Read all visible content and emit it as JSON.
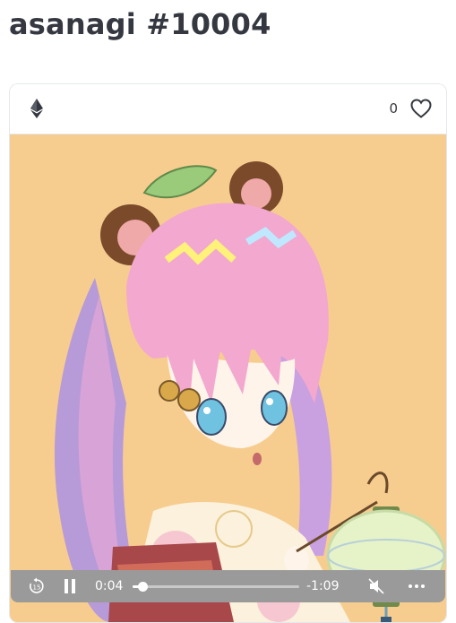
{
  "page": {
    "title": "asanagi #10004"
  },
  "card": {
    "chain_icon": "ethereum-icon",
    "favorites_count": "0",
    "favorite_icon": "heart-outline-icon",
    "image_alt": "Anime girl with pink and purple twin-tail hair and bear ears, wearing a floral kimono, holding a glowing paper lantern"
  },
  "player": {
    "rewind_icon": "rewind-15-icon",
    "rewind_label": "15",
    "pause_icon": "pause-icon",
    "elapsed": "0:04",
    "remaining": "-1:09",
    "progress": 0.057,
    "mute_icon": "muted-speaker-icon",
    "more_icon": "more-options-icon"
  },
  "colors": {
    "background": "#f6cd8f",
    "title_text": "#353840",
    "controls_bg": "#9a9a9a"
  }
}
